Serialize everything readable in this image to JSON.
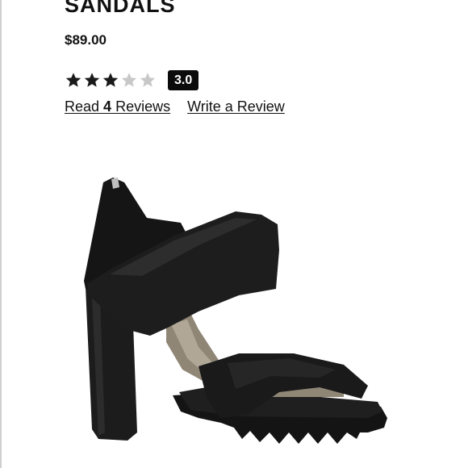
{
  "product": {
    "title": "SANDALS",
    "price": "$89.00",
    "rating": {
      "value": 3,
      "max": 5,
      "badge": "3.0"
    },
    "reviews": {
      "read_prefix": "Read ",
      "count": "4",
      "read_suffix": " Reviews",
      "write_label": "Write a Review"
    },
    "image": {
      "subject": "black platform block-heel sandal"
    }
  },
  "colors": {
    "star_filled": "#1a1a1a",
    "star_empty": "#c8c8c8",
    "badge_bg": "#0b0b0b"
  }
}
